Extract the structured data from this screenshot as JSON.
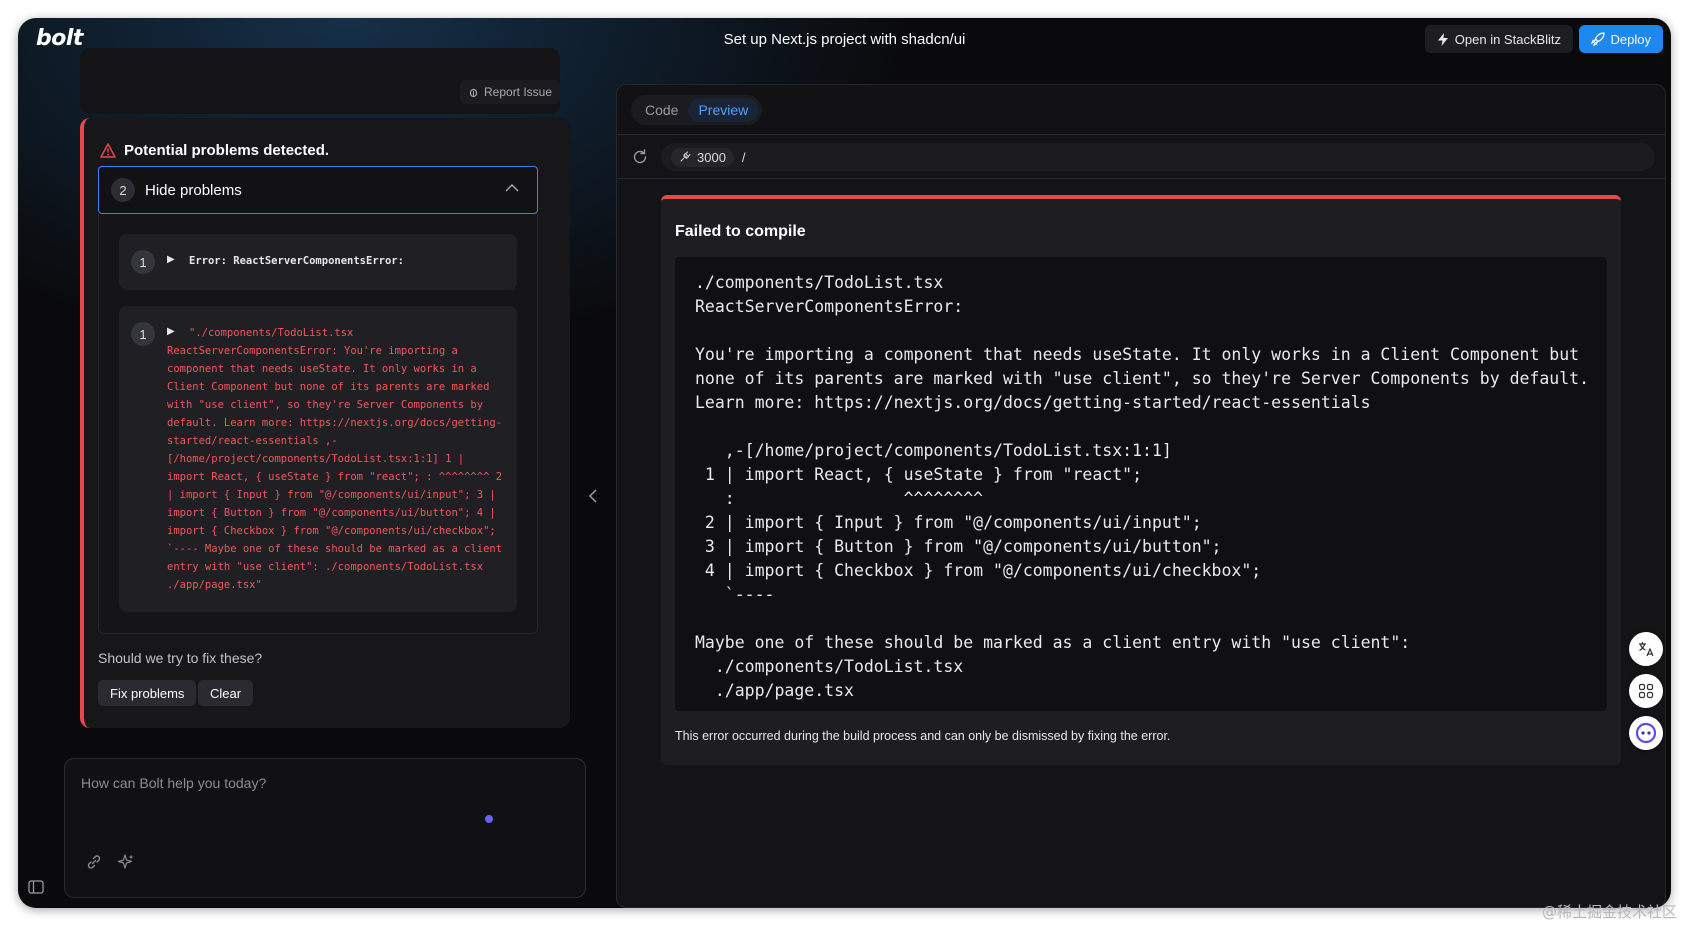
{
  "header": {
    "logo": "bolt",
    "title": "Set up Next.js project with shadcn/ui",
    "open_stackblitz_label": "Open in StackBlitz",
    "deploy_label": "Deploy"
  },
  "chat": {
    "report_issue_label": "Report Issue",
    "problems": {
      "heading": "Potential problems detected.",
      "count": "2",
      "toggle_label": "Hide problems",
      "items": [
        {
          "num": "1",
          "text": "Error: ReactServerComponentsError:"
        },
        {
          "num": "1",
          "text": "\"./components/TodoList.tsx ReactServerComponentsError: You're importing a component that needs useState. It only works in a Client Component but none of its parents are marked with \"use client\", so they're Server Components by default. Learn more: https://nextjs.org/docs/getting-started/react-essentials ,-[/home/project/components/TodoList.tsx:1:1] 1 | import React, { useState } from \"react\"; : ^^^^^^^^ 2 | import { Input } from \"@/components/ui/input\"; 3 | import { Button } from \"@/components/ui/button\"; 4 | import { Checkbox } from \"@/components/ui/checkbox\"; `---- Maybe one of these should be marked as a client entry with \"use client\": ./components/TodoList.tsx ./app/page.tsx\""
        }
      ],
      "fix_question": "Should we try to fix these?",
      "fix_button": "Fix problems",
      "clear_button": "Clear"
    },
    "prompt_placeholder": "How can Bolt help you today?"
  },
  "workbench": {
    "tabs": [
      {
        "label": "Code",
        "active": false
      },
      {
        "label": "Preview",
        "active": true
      }
    ],
    "port": "3000",
    "path": "/",
    "error": {
      "title": "Failed to compile",
      "code": "./components/TodoList.tsx\nReactServerComponentsError:\n\nYou're importing a component that needs useState. It only works in a Client Component but\nnone of its parents are marked with \"use client\", so they're Server Components by default.\nLearn more: https://nextjs.org/docs/getting-started/react-essentials\n\n   ,-[/home/project/components/TodoList.tsx:1:1]\n 1 | import React, { useState } from \"react\";\n   :                 ^^^^^^^^\n 2 | import { Input } from \"@/components/ui/input\";\n 3 | import { Button } from \"@/components/ui/button\";\n 4 | import { Checkbox } from \"@/components/ui/checkbox\";\n   `----\n\nMaybe one of these should be marked as a client entry with \"use client\":\n  ./components/TodoList.tsx\n  ./app/page.tsx",
      "footer": "This error occurred during the build process and can only be dismissed by fixing the error."
    }
  },
  "watermark": "@稀土掘金技术社区",
  "colors": {
    "accent": "#1f88f0",
    "error": "#e5484d",
    "tab_active": "#4ea1ff"
  }
}
